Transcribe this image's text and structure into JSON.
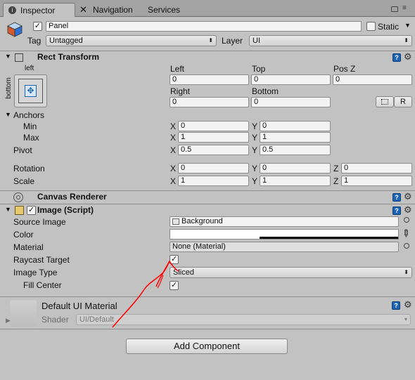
{
  "tabs": [
    {
      "label": "Inspector",
      "icon": "info-icon"
    },
    {
      "label": "Navigation",
      "icon": "navigation-icon"
    },
    {
      "label": "Services"
    }
  ],
  "object": {
    "name": "Panel",
    "active": true,
    "static_label": "Static",
    "static_checked": false,
    "tag_label": "Tag",
    "tag_value": "Untagged",
    "layer_label": "Layer",
    "layer_value": "UI"
  },
  "rect_transform": {
    "title": "Rect Transform",
    "anchor_preset_top": "left",
    "anchor_preset_side": "bottom",
    "cols": {
      "left": "Left",
      "top": "Top",
      "posz": "Pos Z",
      "right": "Right",
      "bottom": "Bottom"
    },
    "values": {
      "left": "0",
      "top": "0",
      "posz": "0",
      "right": "0",
      "bottom": "0"
    },
    "r_button": "R",
    "anchors_label": "Anchors",
    "min_label": "Min",
    "max_label": "Max",
    "pivot_label": "Pivot",
    "rotation_label": "Rotation",
    "scale_label": "Scale",
    "axis": {
      "x": "X",
      "y": "Y",
      "z": "Z"
    },
    "min": {
      "x": "0",
      "y": "0"
    },
    "max": {
      "x": "1",
      "y": "1"
    },
    "pivot": {
      "x": "0.5",
      "y": "0.5"
    },
    "rotation": {
      "x": "0",
      "y": "0",
      "z": "0"
    },
    "scale": {
      "x": "1",
      "y": "1",
      "z": "1"
    }
  },
  "canvas_renderer": {
    "title": "Canvas Renderer"
  },
  "image_script": {
    "title": "Image (Script)",
    "enabled": true,
    "source_image_label": "Source Image",
    "source_image_value": "Background",
    "color_label": "Color",
    "color_value": "#ffffff",
    "material_label": "Material",
    "material_value": "None (Material)",
    "raycast_label": "Raycast Target",
    "raycast_checked": true,
    "image_type_label": "Image Type",
    "image_type_value": "Sliced",
    "fill_center_label": "Fill Center",
    "fill_center_checked": true
  },
  "material_panel": {
    "title": "Default UI Material",
    "shader_label": "Shader",
    "shader_value": "UI/Default"
  },
  "add_component": "Add Component",
  "annotation_color": "#ff0000"
}
